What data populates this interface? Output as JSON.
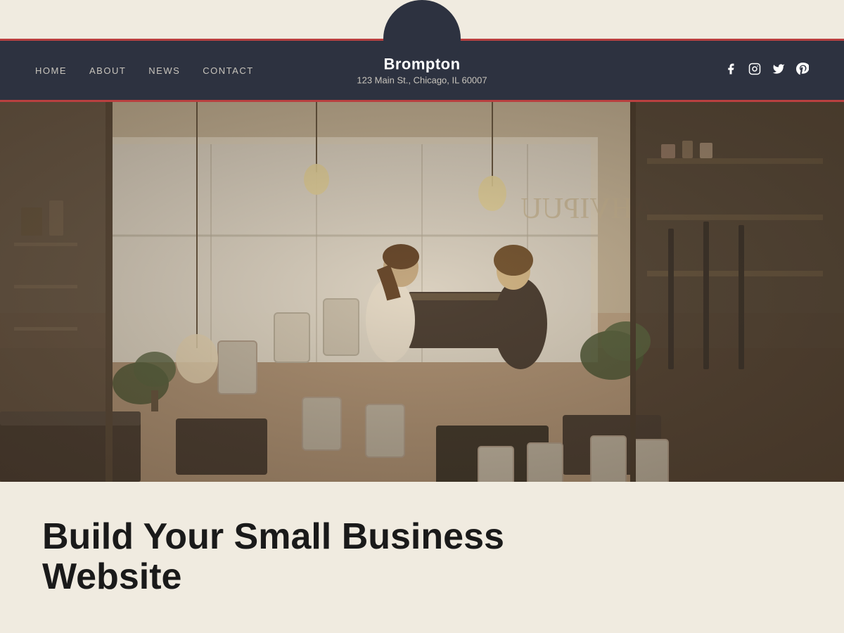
{
  "topStrip": {
    "backgroundColor": "#f0ebe0"
  },
  "header": {
    "backgroundColor": "#2d3240",
    "accentColor": "#b94040",
    "siteName": "Brompton",
    "siteAddress": "123 Main St., Chicago, IL 60007",
    "nav": [
      {
        "label": "HOME",
        "active": false
      },
      {
        "label": "ABOUT",
        "active": false
      },
      {
        "label": "NEWS",
        "active": false
      },
      {
        "label": "CONTACT",
        "active": false
      }
    ],
    "socialIcons": [
      {
        "name": "facebook",
        "symbol": "f"
      },
      {
        "name": "instagram",
        "symbol": "⊙"
      },
      {
        "name": "twitter",
        "symbol": "𝕏"
      },
      {
        "name": "pinterest",
        "symbol": "P"
      }
    ]
  },
  "hero": {
    "altText": "Cafe interior with two women sitting at a table"
  },
  "bottomSection": {
    "headingLine1": "Build Your Small Business",
    "headingLine2": "Website"
  }
}
